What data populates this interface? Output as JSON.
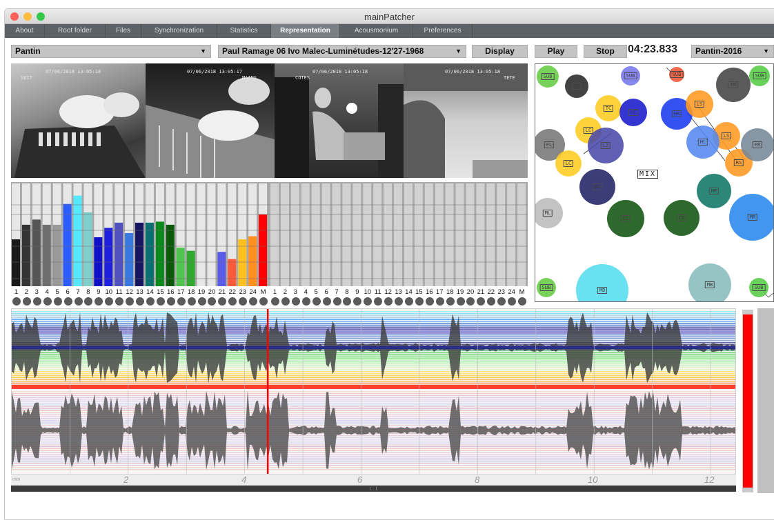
{
  "window": {
    "title": "mainPatcher"
  },
  "tabs": [
    {
      "label": "About"
    },
    {
      "label": "Root folder"
    },
    {
      "label": "Files"
    },
    {
      "label": "Synchronization"
    },
    {
      "label": "Statistics"
    },
    {
      "label": "Representation",
      "active": true
    },
    {
      "label": "Acousmonium"
    },
    {
      "label": "Preferences"
    }
  ],
  "toolbar": {
    "venue": "Pantin",
    "piece": "Paul Ramage 06 Ivo Malec-Luminétudes-12'27-1968",
    "display_label": "Display",
    "play_label": "Play",
    "stop_label": "Stop",
    "time": "04:23.833",
    "preset": "Pantin-2016"
  },
  "videos": [
    {
      "timestamp": "07/06/2018 13:05:18",
      "camera": "SUIT"
    },
    {
      "timestamp": "07/06/2018 13:05:17",
      "camera": "MAINS"
    },
    {
      "timestamp": "07/06/2018 13:05:18",
      "camera": "COTES"
    },
    {
      "timestamp": "07/06/2018 13:05:18",
      "camera": "TETE"
    }
  ],
  "meters": {
    "left_labels": [
      "1",
      "2",
      "3",
      "4",
      "5",
      "6",
      "7",
      "8",
      "9",
      "10",
      "11",
      "12",
      "13",
      "14",
      "15",
      "16",
      "17",
      "18",
      "19",
      "20",
      "21",
      "22",
      "23",
      "24",
      "M"
    ],
    "right_labels": [
      "1",
      "2",
      "3",
      "4",
      "5",
      "6",
      "7",
      "8",
      "9",
      "10",
      "11",
      "12",
      "13",
      "14",
      "15",
      "16",
      "17",
      "18",
      "19",
      "20",
      "21",
      "22",
      "23",
      "24",
      "M"
    ],
    "levels": [
      0.45,
      0.59,
      0.64,
      0.59,
      0.59,
      0.79,
      0.87,
      0.71,
      0.47,
      0.56,
      0.61,
      0.51,
      0.61,
      0.61,
      0.62,
      0.59,
      0.37,
      0.34,
      0,
      0,
      0.33,
      0.26,
      0.45,
      0.48,
      0.69
    ],
    "colors": [
      "#1a1a1a",
      "#333333",
      "#555555",
      "#6e6e6e",
      "#999999",
      "#2a5cff",
      "#55e8ff",
      "#7fd0cc",
      "#1010c8",
      "#1f1fe0",
      "#5050c0",
      "#3878e0",
      "#151560",
      "#087070",
      "#0a8a1a",
      "#0a5a0a",
      "#4fc44f",
      "#2fa82f",
      "#bbbbbb",
      "#bbbbbb",
      "#5a5ae8",
      "#ff5a3a",
      "#ffc020",
      "#ff9020",
      "#ff0000"
    ]
  },
  "spatial": {
    "mix_label": "MIX",
    "speakers": [
      {
        "label": "SUB",
        "color": "#66cc44"
      },
      {
        "label": "RR",
        "color": "#2a2a2a"
      },
      {
        "label": "SUB",
        "color": "#7777ee"
      },
      {
        "label": "SUB",
        "color": "#ee5533"
      },
      {
        "label": "FR",
        "color": "#444444"
      },
      {
        "label": "SUB",
        "color": "#55cc44"
      },
      {
        "label": "TC",
        "color": "#ffcc22"
      },
      {
        "label": "FC",
        "color": "#1a1acc"
      },
      {
        "label": "HR",
        "color": "#1a3aee"
      },
      {
        "label": "LS",
        "color": "#ff9922"
      },
      {
        "label": "FL",
        "color": "#777777"
      },
      {
        "label": "LC",
        "color": "#ffcc22"
      },
      {
        "label": "L2",
        "color": "#4a4aaa"
      },
      {
        "label": "LS",
        "color": "#ff9922"
      },
      {
        "label": "HL",
        "color": "#5588ee"
      },
      {
        "label": "RS",
        "color": "#ff9922"
      },
      {
        "label": "FR",
        "color": "#778899"
      },
      {
        "label": "LC",
        "color": "#ffcc22"
      },
      {
        "label": "HL",
        "color": "#222266"
      },
      {
        "label": "HR",
        "color": "#117766"
      },
      {
        "label": "ML",
        "color": "#bbbbbb"
      },
      {
        "label": "CL",
        "color": "#115511"
      },
      {
        "label": "CR",
        "color": "#115511"
      },
      {
        "label": "MR",
        "color": "#2a88ee"
      },
      {
        "label": "SUB",
        "color": "#66cc44"
      },
      {
        "label": "MB",
        "color": "#55ddee"
      },
      {
        "label": "MB",
        "color": "#88bbbb"
      },
      {
        "label": "SUB",
        "color": "#55cc44"
      }
    ]
  },
  "timeline": {
    "ticks": [
      "2",
      "4",
      "6",
      "8",
      "10",
      "12"
    ],
    "unit_label": "min",
    "playhead_minutes": 4.397,
    "total_minutes": 12.45
  },
  "colors": {
    "accent": "#ff0000",
    "tab_active": "#7a7f85",
    "tab_bar": "#5d6268"
  }
}
